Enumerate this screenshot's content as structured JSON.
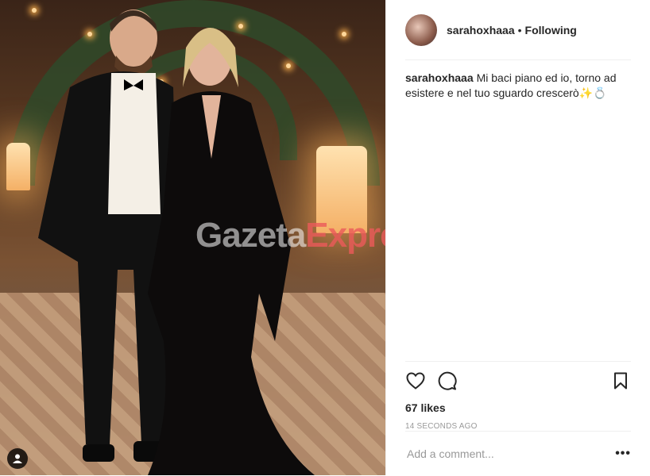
{
  "post": {
    "username": "sarahoxhaaa",
    "separator": "•",
    "follow_status": "Following",
    "caption": {
      "username": "sarahoxhaaa",
      "text": "Mi baci piano ed io, torno ad esistere e nel tuo sguardo crescerò✨💍"
    },
    "likes": "67 likes",
    "timestamp": "14 SECONDS AGO",
    "comment_placeholder": "Add a comment...",
    "more_options": "•••"
  },
  "media": {
    "watermark_part1": "Gazeta",
    "watermark_part2": "Express"
  },
  "icons": {
    "like": "heart-icon",
    "comment": "comment-icon",
    "save": "bookmark-icon",
    "tags": "user-tag-icon"
  },
  "colors": {
    "text": "#262626",
    "secondary": "#999999",
    "border": "#efefef"
  }
}
